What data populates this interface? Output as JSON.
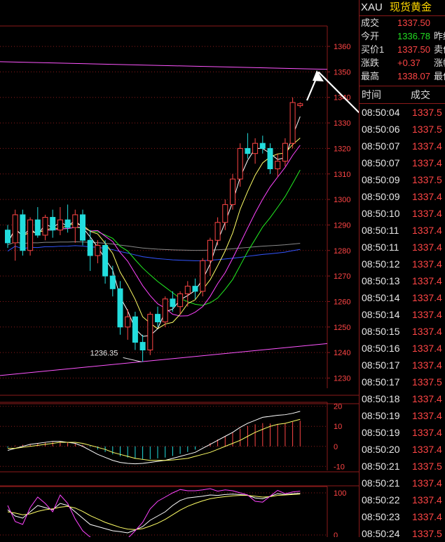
{
  "quote": {
    "symbol": "XAU",
    "name": "现货黄金",
    "rows": [
      {
        "label": "成交",
        "value": "1337.50",
        "color": "up",
        "label2": ""
      },
      {
        "label": "今开",
        "value": "1336.78",
        "color": "down",
        "label2": "昨结"
      },
      {
        "label": "买价1",
        "value": "1337.50",
        "color": "up",
        "label2": "卖价"
      },
      {
        "label": "涨跌",
        "value": "+0.37",
        "color": "up",
        "label2": "涨幅"
      },
      {
        "label": "最高",
        "value": "1338.07",
        "color": "up",
        "label2": "最低"
      }
    ]
  },
  "ticks": {
    "header_time": "时间",
    "header_price": "成交",
    "rows": [
      {
        "time": "08:50:04",
        "price": "1337.5"
      },
      {
        "time": "08:50:06",
        "price": "1337.5"
      },
      {
        "time": "08:50:07",
        "price": "1337.4"
      },
      {
        "time": "08:50:07",
        "price": "1337.4"
      },
      {
        "time": "08:50:09",
        "price": "1337.5"
      },
      {
        "time": "08:50:09",
        "price": "1337.4"
      },
      {
        "time": "08:50:10",
        "price": "1337.4"
      },
      {
        "time": "08:50:11",
        "price": "1337.4"
      },
      {
        "time": "08:50:11",
        "price": "1337.4"
      },
      {
        "time": "08:50:12",
        "price": "1337.4"
      },
      {
        "time": "08:50:13",
        "price": "1337.4"
      },
      {
        "time": "08:50:14",
        "price": "1337.4"
      },
      {
        "time": "08:50:14",
        "price": "1337.4"
      },
      {
        "time": "08:50:15",
        "price": "1337.4"
      },
      {
        "time": "08:50:16",
        "price": "1337.4"
      },
      {
        "time": "08:50:17",
        "price": "1337.4"
      },
      {
        "time": "08:50:17",
        "price": "1337.5"
      },
      {
        "time": "08:50:18",
        "price": "1337.4"
      },
      {
        "time": "08:50:19",
        "price": "1337.4"
      },
      {
        "time": "08:50:19",
        "price": "1337.4"
      },
      {
        "time": "08:50:20",
        "price": "1337.4"
      },
      {
        "time": "08:50:21",
        "price": "1337.5"
      },
      {
        "time": "08:50:21",
        "price": "1337.4"
      },
      {
        "time": "08:50:22",
        "price": "1337.4"
      },
      {
        "time": "08:50:23",
        "price": "1337.4"
      },
      {
        "time": "08:50:24",
        "price": "1337.5"
      }
    ]
  },
  "colors": {
    "up": "#ff4545",
    "down": "#22dddd",
    "grid": "#8b1a1a",
    "ma5": "#ffffff",
    "ma10": "#ffff66",
    "ma20": "#ff44ff",
    "ma40": "#22ee22",
    "ma60": "#3355ff",
    "ma120": "#888888",
    "trendline": "#ff55ff"
  },
  "chart_data": [
    {
      "type": "candlestick",
      "title": "",
      "ylim": [
        1226,
        1368
      ],
      "y_ticks": [
        "1360",
        "1350",
        "1340",
        "1330",
        "1320",
        "1310",
        "1300",
        "1290",
        "1280",
        "1270",
        "1260",
        "1250",
        "1240",
        "1230"
      ],
      "annotation": "1236.35",
      "annotation_value": 1236.35,
      "candles": [
        {
          "o": 1288,
          "h": 1290,
          "l": 1281,
          "c": 1283
        },
        {
          "o": 1283,
          "h": 1296,
          "l": 1276,
          "c": 1294
        },
        {
          "o": 1294,
          "h": 1296,
          "l": 1278,
          "c": 1280
        },
        {
          "o": 1280,
          "h": 1293,
          "l": 1278,
          "c": 1292
        },
        {
          "o": 1292,
          "h": 1297,
          "l": 1285,
          "c": 1286
        },
        {
          "o": 1286,
          "h": 1294,
          "l": 1284,
          "c": 1293
        },
        {
          "o": 1293,
          "h": 1296,
          "l": 1285,
          "c": 1288
        },
        {
          "o": 1288,
          "h": 1297,
          "l": 1286,
          "c": 1292
        },
        {
          "o": 1292,
          "h": 1298,
          "l": 1287,
          "c": 1289
        },
        {
          "o": 1289,
          "h": 1296,
          "l": 1283,
          "c": 1294
        },
        {
          "o": 1294,
          "h": 1296,
          "l": 1282,
          "c": 1284
        },
        {
          "o": 1284,
          "h": 1288,
          "l": 1272,
          "c": 1278
        },
        {
          "o": 1278,
          "h": 1284,
          "l": 1275,
          "c": 1282
        },
        {
          "o": 1282,
          "h": 1284,
          "l": 1267,
          "c": 1270
        },
        {
          "o": 1270,
          "h": 1274,
          "l": 1262,
          "c": 1265
        },
        {
          "o": 1265,
          "h": 1268,
          "l": 1247,
          "c": 1250
        },
        {
          "o": 1250,
          "h": 1257,
          "l": 1245,
          "c": 1254
        },
        {
          "o": 1254,
          "h": 1256,
          "l": 1241,
          "c": 1244
        },
        {
          "o": 1244,
          "h": 1247,
          "l": 1236.35,
          "c": 1241
        },
        {
          "o": 1241,
          "h": 1256,
          "l": 1239,
          "c": 1255
        },
        {
          "o": 1255,
          "h": 1258,
          "l": 1250,
          "c": 1252
        },
        {
          "o": 1252,
          "h": 1262,
          "l": 1250,
          "c": 1261
        },
        {
          "o": 1261,
          "h": 1264,
          "l": 1256,
          "c": 1258
        },
        {
          "o": 1258,
          "h": 1264,
          "l": 1255,
          "c": 1263
        },
        {
          "o": 1263,
          "h": 1268,
          "l": 1258,
          "c": 1266
        },
        {
          "o": 1266,
          "h": 1269,
          "l": 1261,
          "c": 1264
        },
        {
          "o": 1264,
          "h": 1277,
          "l": 1262,
          "c": 1276
        },
        {
          "o": 1276,
          "h": 1285,
          "l": 1270,
          "c": 1284
        },
        {
          "o": 1284,
          "h": 1293,
          "l": 1282,
          "c": 1291
        },
        {
          "o": 1291,
          "h": 1300,
          "l": 1288,
          "c": 1298
        },
        {
          "o": 1298,
          "h": 1310,
          "l": 1296,
          "c": 1308
        },
        {
          "o": 1308,
          "h": 1322,
          "l": 1305,
          "c": 1320
        },
        {
          "o": 1320,
          "h": 1326,
          "l": 1316,
          "c": 1318
        },
        {
          "o": 1318,
          "h": 1324,
          "l": 1314,
          "c": 1322
        },
        {
          "o": 1322,
          "h": 1325,
          "l": 1318,
          "c": 1320
        },
        {
          "o": 1320,
          "h": 1322,
          "l": 1310,
          "c": 1312
        },
        {
          "o": 1312,
          "h": 1318,
          "l": 1309,
          "c": 1315
        },
        {
          "o": 1315,
          "h": 1324,
          "l": 1313,
          "c": 1322
        },
        {
          "o": 1322,
          "h": 1340,
          "l": 1320,
          "c": 1338
        },
        {
          "o": 1336.78,
          "h": 1338.07,
          "l": 1336,
          "c": 1337.5
        }
      ]
    },
    {
      "type": "bar",
      "title": "",
      "ylim": [
        -12,
        22
      ],
      "y_ticks": [
        "20",
        "10",
        "0",
        "-10"
      ],
      "values": [
        -0.6,
        0.4,
        0.8,
        1.2,
        1.5,
        1.8,
        2.2,
        2.6,
        2.2,
        1.6,
        0.8,
        -0.4,
        -1.6,
        -2.8,
        -4.0,
        -5.0,
        -5.6,
        -6.2,
        -6.6,
        -6.4,
        -6.0,
        -5.6,
        -4.8,
        -3.8,
        -2.8,
        -1.6,
        -0.2,
        1.6,
        3.4,
        5.2,
        7.0,
        8.8,
        10.2,
        11.0,
        11.6,
        11.4,
        11.2,
        11.4,
        12.2,
        12.8
      ],
      "dif": [
        -2,
        -1,
        0,
        1,
        1.5,
        2,
        2.5,
        2.5,
        2,
        1.5,
        0,
        -2,
        -4,
        -5.5,
        -7,
        -8,
        -8.5,
        -8.7,
        -8.5,
        -8,
        -7.5,
        -7,
        -6,
        -5,
        -4,
        -3,
        -1,
        1,
        3,
        5,
        7,
        9.5,
        11.5,
        13,
        14.5,
        15,
        15.5,
        15.8,
        16.5,
        17.5
      ],
      "dea": [
        -1,
        -1,
        -0.5,
        0,
        0.5,
        1,
        1.5,
        2,
        2,
        2,
        1.5,
        0.5,
        -0.5,
        -1.5,
        -3,
        -4,
        -5,
        -6,
        -6.5,
        -7,
        -7,
        -7,
        -6.8,
        -6.4,
        -6,
        -5,
        -4,
        -3,
        -1.5,
        0,
        1.5,
        3,
        5,
        7,
        8.5,
        10,
        11,
        11.5,
        12.5,
        13.5
      ]
    },
    {
      "type": "line",
      "title": "",
      "ylim": [
        -5,
        115
      ],
      "y_ticks": [
        "100",
        "0"
      ],
      "k": [
        60,
        45,
        40,
        55,
        70,
        65,
        60,
        75,
        70,
        55,
        40,
        25,
        20,
        15,
        10,
        8,
        5,
        12,
        20,
        35,
        45,
        55,
        70,
        82,
        88,
        90,
        92,
        95,
        94,
        96,
        97,
        96,
        94,
        88,
        86,
        92,
        98,
        96,
        98,
        99
      ],
      "d": [
        55,
        52,
        48,
        50,
        56,
        60,
        62,
        66,
        68,
        64,
        56,
        46,
        38,
        30,
        24,
        18,
        14,
        13,
        15,
        21,
        28,
        37,
        48,
        59,
        68,
        75,
        81,
        86,
        89,
        91,
        93,
        94,
        94,
        92,
        90,
        91,
        94,
        95,
        96,
        97
      ],
      "j": [
        70,
        32,
        25,
        65,
        90,
        75,
        55,
        95,
        75,
        38,
        10,
        -5,
        -12,
        -15,
        -18,
        -10,
        -8,
        10,
        30,
        62,
        80,
        90,
        100,
        108,
        105,
        105,
        107,
        110,
        104,
        107,
        105,
        100,
        95,
        80,
        78,
        92,
        106,
        98,
        102,
        104
      ]
    }
  ]
}
